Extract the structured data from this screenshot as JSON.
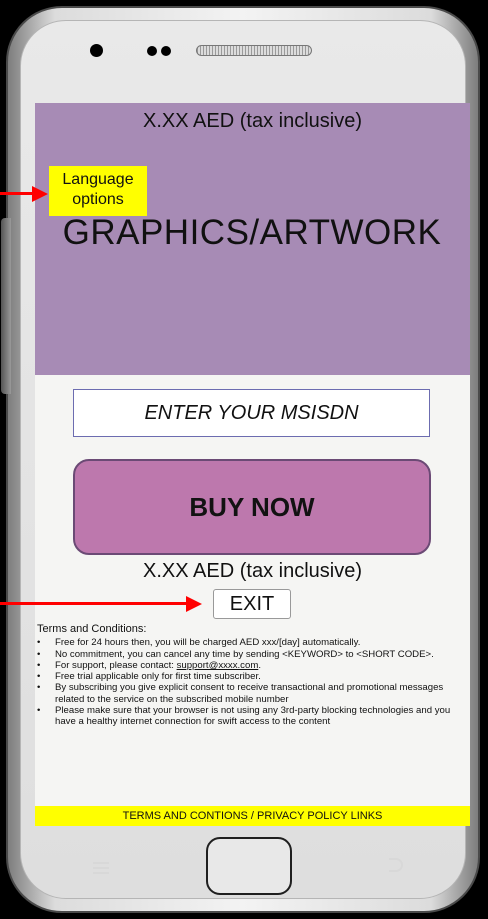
{
  "hero": {
    "price_top": "X.XX AED  (tax inclusive)",
    "graphics_placeholder": "GRAPHICS/ARTWORK"
  },
  "annotations": {
    "language_options": "Language options"
  },
  "form": {
    "msisdn_placeholder": "ENTER YOUR MSISDN",
    "buy_label": "BUY NOW",
    "price_bottom": "X.XX AED  (tax inclusive)",
    "exit_label": "EXIT"
  },
  "terms": {
    "title": "Terms and Conditions:",
    "items": [
      "Free for 24 hours then, you will be charged AED xxx/[day] automatically.",
      "No commitment, you can cancel any time by sending <KEYWORD> to <SHORT CODE>.",
      "For support, please contact: ",
      "Free trial applicable only for first time subscriber.",
      "By subscribing you give explicit consent to receive transactional and promotional messages related to the service on the subscribed mobile number",
      "Please make sure that your browser is not using any 3rd-party blocking technologies and you have a healthy internet connection for swift access to the content"
    ],
    "support_email": "support@xxxx.com",
    "support_suffix": "."
  },
  "footer": {
    "links": "TERMS AND CONTIONS / PRIVACY POLICY LINKS"
  },
  "colors": {
    "hero_bg": "#a78bb5",
    "buy_bg": "#bd78ad",
    "highlight": "#ffff00",
    "arrow": "#ff0000"
  }
}
